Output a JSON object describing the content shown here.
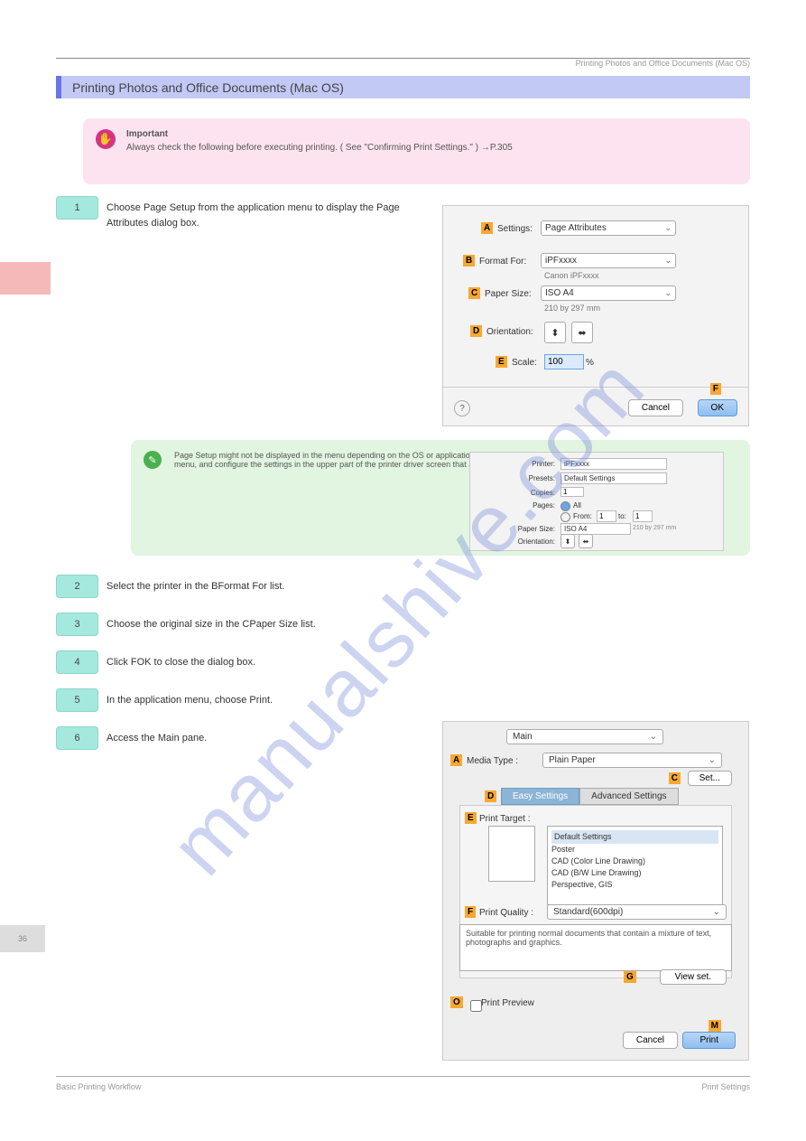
{
  "header": {
    "left_crumb": "",
    "right_crumb": "Printing Photos and Office Documents (Mac OS)"
  },
  "title_bar": "Printing Photos and Office Documents (Mac OS)",
  "important": {
    "label": "Important",
    "text": "Always check the following before executing printing. ( See \"Confirming Print Settings.\" ) →P.305"
  },
  "steps": {
    "s1": {
      "num": "1",
      "text": "Choose Page Setup from the application menu to display the Page Attributes dialog box."
    },
    "s2": {
      "num": "2",
      "text": "Select the printer in the BFormat For list."
    },
    "s3": {
      "num": "3",
      "text": "Choose the original size in the CPaper Size list."
    },
    "s4": {
      "num": "4",
      "text": "Click FOK to close the dialog box."
    },
    "s5": {
      "num": "5",
      "text": "In the application menu, choose Print."
    },
    "s6": {
      "num": "6",
      "text": "Access the Main pane."
    }
  },
  "note_text": "Page Setup might not be displayed in the menu depending on the OS or application software. In this case, select Print in the OS or application software menu, and configure the settings in the upper part of the printer driver screen that appears.",
  "dialog1": {
    "settings_label": "Settings:",
    "settings_value": "Page Attributes",
    "format_label": "Format For:",
    "format_value": "iPFxxxx",
    "format_sub": "Canon iPFxxxx",
    "paper_label": "Paper Size:",
    "paper_value": "ISO A4",
    "paper_sub": "210 by 297 mm",
    "orient_label": "Orientation:",
    "scale_label": "Scale:",
    "scale_value": "100",
    "scale_pct": "%",
    "cancel": "Cancel",
    "ok": "OK",
    "markers": {
      "A": "A",
      "B": "B",
      "C": "C",
      "D": "D",
      "E": "E",
      "F": "F"
    }
  },
  "mini_dialog": {
    "printer_label": "Printer:",
    "printer_value": "iPFxxxx",
    "presets_label": "Presets:",
    "presets_value": "Default Settings",
    "copies_label": "Copies:",
    "copies_value": "1",
    "pages_label": "Pages:",
    "all": "All",
    "from": "From:",
    "from_v": "1",
    "to": "to:",
    "to_v": "1",
    "psize_label": "Paper Size:",
    "psize_value": "ISO A4",
    "psize_sub": "210 by 297 mm",
    "orient_label": "Orientation:"
  },
  "dialog2": {
    "top_select": "Main",
    "media_label": "Media Type :",
    "media_value": "Plain Paper",
    "set_button": "Set...",
    "tab_easy": "Easy Settings",
    "tab_adv": "Advanced Settings",
    "target_label": "Print Target :",
    "target_items": [
      "Default Settings",
      "Poster",
      "CAD (Color Line Drawing)",
      "CAD (B/W Line Drawing)",
      "Perspective, GIS"
    ],
    "quality_label": "Print Quality :",
    "quality_value": "Standard(600dpi)",
    "desc": "Suitable for printing normal documents that contain a mixture of text, photographs and graphics.",
    "viewset": "View set.",
    "preview": "Print Preview",
    "cancel": "Cancel",
    "print": "Print",
    "markers": {
      "A": "A",
      "C": "C",
      "D": "D",
      "E": "E",
      "F": "F",
      "G": "G",
      "O": "O",
      "M": "M"
    }
  },
  "page_num": "36",
  "footer_left": "Basic Printing Workflow",
  "footer_right": "Print Settings",
  "watermark": "manualshive.com"
}
